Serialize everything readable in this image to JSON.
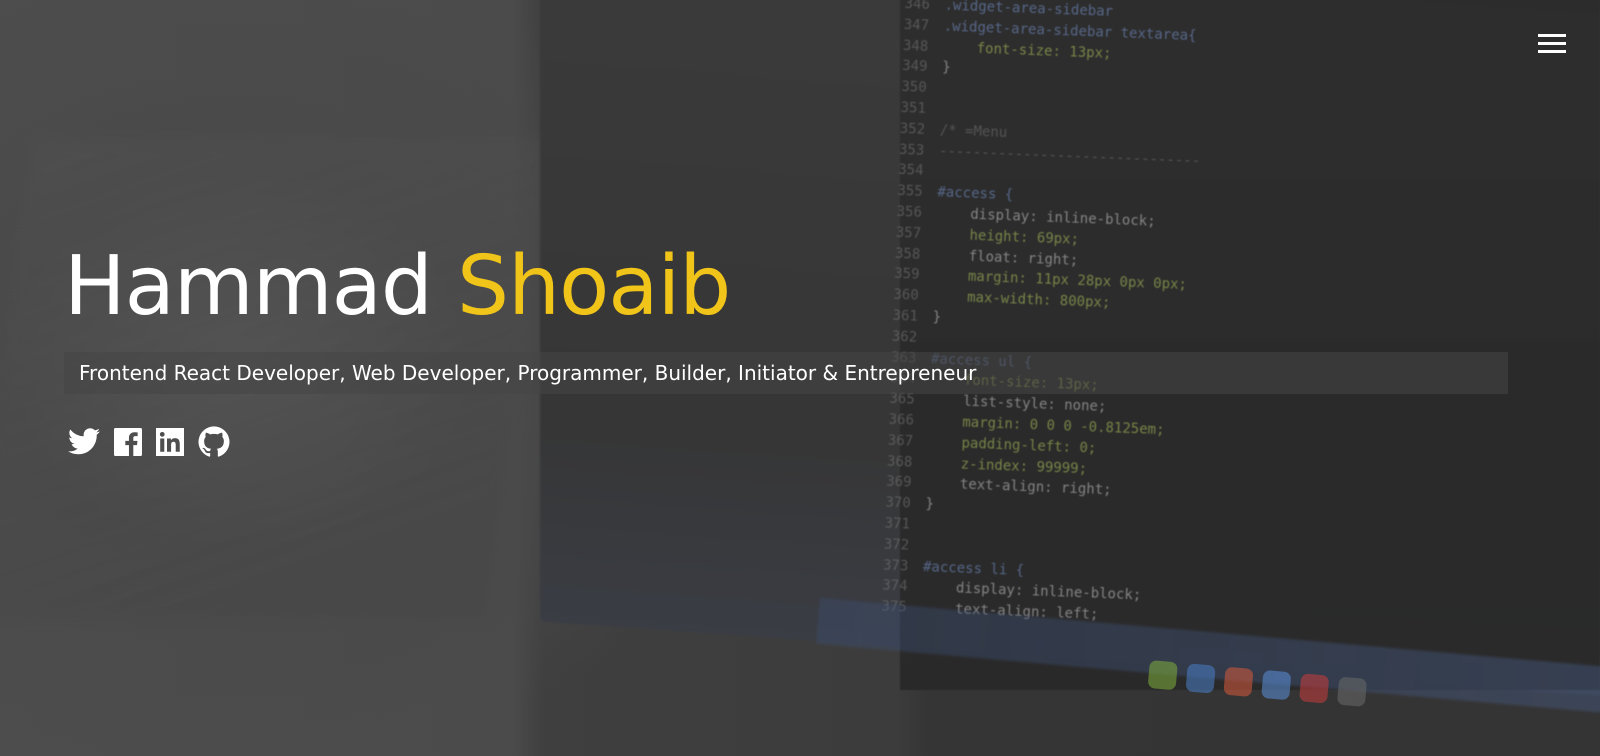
{
  "hero": {
    "first_name": "Hammad",
    "last_name": "Shoaib",
    "tagline": "Frontend React Developer, Web Developer, Programmer, Builder, Initiator & Entrepreneur",
    "accent_color": "#f0c419",
    "text_color": "#ffffff"
  },
  "menu": {
    "icon": "hamburger-menu-icon"
  },
  "social": [
    {
      "icon": "twitter-icon"
    },
    {
      "icon": "facebook-icon"
    },
    {
      "icon": "linkedin-icon"
    },
    {
      "icon": "github-icon"
    }
  ],
  "background_code": [
    {
      "n": "346",
      "t": ".widget-area-sidebar"
    },
    {
      "n": "347",
      "t": ".widget-area-sidebar textarea{"
    },
    {
      "n": "348",
      "t": "    font-size: 13px;"
    },
    {
      "n": "349",
      "t": "}"
    },
    {
      "n": "350",
      "t": ""
    },
    {
      "n": "351",
      "t": ""
    },
    {
      "n": "352",
      "t": "/* =Menu"
    },
    {
      "n": "353",
      "t": "-------------------------------"
    },
    {
      "n": "354",
      "t": ""
    },
    {
      "n": "355",
      "t": "#access {"
    },
    {
      "n": "356",
      "t": "    display: inline-block;"
    },
    {
      "n": "357",
      "t": "    height: 69px;"
    },
    {
      "n": "358",
      "t": "    float: right;"
    },
    {
      "n": "359",
      "t": "    margin: 11px 28px 0px 0px;"
    },
    {
      "n": "360",
      "t": "    max-width: 800px;"
    },
    {
      "n": "361",
      "t": "}"
    },
    {
      "n": "362",
      "t": ""
    },
    {
      "n": "363",
      "t": "#access ul {"
    },
    {
      "n": "364",
      "t": "    font-size: 13px;"
    },
    {
      "n": "365",
      "t": "    list-style: none;"
    },
    {
      "n": "366",
      "t": "    margin: 0 0 0 -0.8125em;"
    },
    {
      "n": "367",
      "t": "    padding-left: 0;"
    },
    {
      "n": "368",
      "t": "    z-index: 99999;"
    },
    {
      "n": "369",
      "t": "    text-align: right;"
    },
    {
      "n": "370",
      "t": "}"
    },
    {
      "n": "371",
      "t": ""
    },
    {
      "n": "372",
      "t": ""
    },
    {
      "n": "373",
      "t": "#access li {"
    },
    {
      "n": "374",
      "t": "    display: inline-block;"
    },
    {
      "n": "375",
      "t": "    text-align: left;"
    }
  ]
}
